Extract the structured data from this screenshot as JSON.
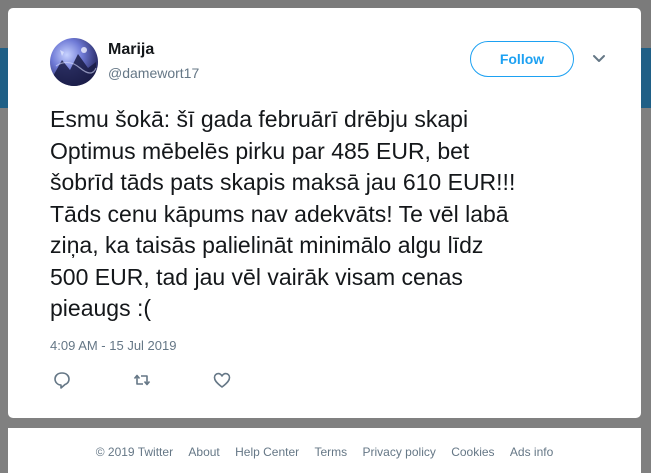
{
  "tweet": {
    "author_name": "Marija",
    "author_handle": "@damewort17",
    "follow_label": "Follow",
    "text": "Esmu šokā: šī gada februārī drēbju skapi\nOptimus mēbelēs pirku par 485 EUR, bet\nšobrīd tāds pats skapis maksā jau 610 EUR!!!\nTāds cenu kāpums nav adekvāts! Te vēl labā\nziņa, ka taisās palielināt minimālo algu līdz\n500 EUR, tad jau vēl vairāk visam cenas\npieaugs :(",
    "timestamp": "4:09 AM - 15 Jul 2019",
    "icons": [
      "reply-icon",
      "retweet-icon",
      "like-icon",
      "chevron-down-icon"
    ]
  },
  "footer": {
    "links": [
      "© 2019 Twitter",
      "About",
      "Help Center",
      "Terms",
      "Privacy policy",
      "Cookies",
      "Ads info"
    ]
  },
  "colors": {
    "accent": "#1da1f2",
    "text_primary": "#14171a",
    "text_secondary": "#657786"
  }
}
